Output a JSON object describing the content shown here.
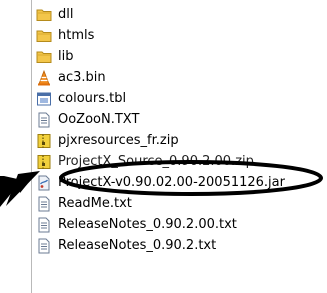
{
  "file_list": {
    "items": [
      {
        "label": "dll",
        "icon": "folder-icon"
      },
      {
        "label": "htmls",
        "icon": "folder-icon"
      },
      {
        "label": "lib",
        "icon": "folder-icon"
      },
      {
        "label": "ac3.bin",
        "icon": "vlc-cone-icon"
      },
      {
        "label": "colours.tbl",
        "icon": "table-file-icon"
      },
      {
        "label": "OoZooN.TXT",
        "icon": "text-file-icon"
      },
      {
        "label": "pjxresources_fr.zip",
        "icon": "zip-archive-icon"
      },
      {
        "label": "ProjectX_Source_0.90.2.00.zip",
        "icon": "zip-archive-icon"
      },
      {
        "label": "ProjectX-v0.90.02.00-20051126.jar",
        "icon": "jar-file-icon"
      },
      {
        "label": "ReadMe.txt",
        "icon": "text-file-icon"
      },
      {
        "label": "ReleaseNotes_0.90.2.00.txt",
        "icon": "text-file-icon"
      },
      {
        "label": "ReleaseNotes_0.90.2.txt",
        "icon": "text-file-icon"
      }
    ]
  },
  "annotation": {
    "circled_item": "ProjectX-v0.90.02.00-20051126.jar",
    "color": "#000000"
  },
  "colors": {
    "folder": "#f3c64a",
    "folder_edge": "#b58b1c",
    "vlc_orange": "#f08a1c",
    "zip_yellow": "#f2d13c"
  }
}
